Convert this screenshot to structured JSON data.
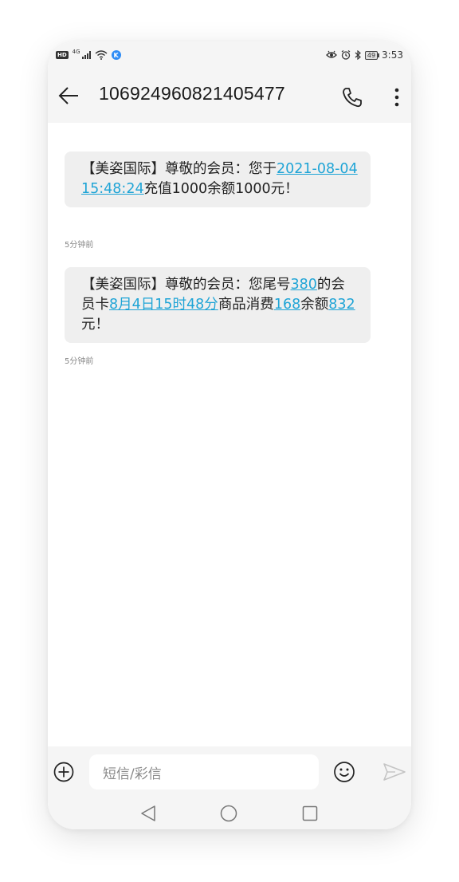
{
  "status_bar": {
    "hd": "HD",
    "network": "4G",
    "k_badge": "K",
    "battery": "49",
    "time": "3:53"
  },
  "header": {
    "title": "106924960821405477"
  },
  "messages": [
    {
      "segments": [
        {
          "text": "【美姿国际】尊敬的会员：您于",
          "link": false
        },
        {
          "text": "2021-08-04 15:48:24",
          "link": true
        },
        {
          "text": "充值1000余额1000元！",
          "link": false
        }
      ],
      "time": "5分钟前"
    },
    {
      "segments": [
        {
          "text": "【美姿国际】尊敬的会员：您尾号",
          "link": false
        },
        {
          "text": "380",
          "link": true
        },
        {
          "text": "的会员卡",
          "link": false
        },
        {
          "text": "8月4日15时48分",
          "link": true
        },
        {
          "text": "商品消费",
          "link": false
        },
        {
          "text": "168",
          "link": true
        },
        {
          "text": "余额",
          "link": false
        },
        {
          "text": "832",
          "link": true
        },
        {
          "text": "元！",
          "link": false
        }
      ],
      "time": "5分钟前"
    }
  ],
  "input": {
    "placeholder": "短信/彩信"
  },
  "icons": {
    "back": "arrow-left-icon",
    "call": "phone-icon",
    "more": "more-vertical-icon",
    "add": "plus-circle-icon",
    "emoji": "smiley-icon",
    "send": "send-icon"
  },
  "colors": {
    "link": "#1fa4d6",
    "bubble": "#efefef",
    "bar": "#f5f5f5"
  }
}
